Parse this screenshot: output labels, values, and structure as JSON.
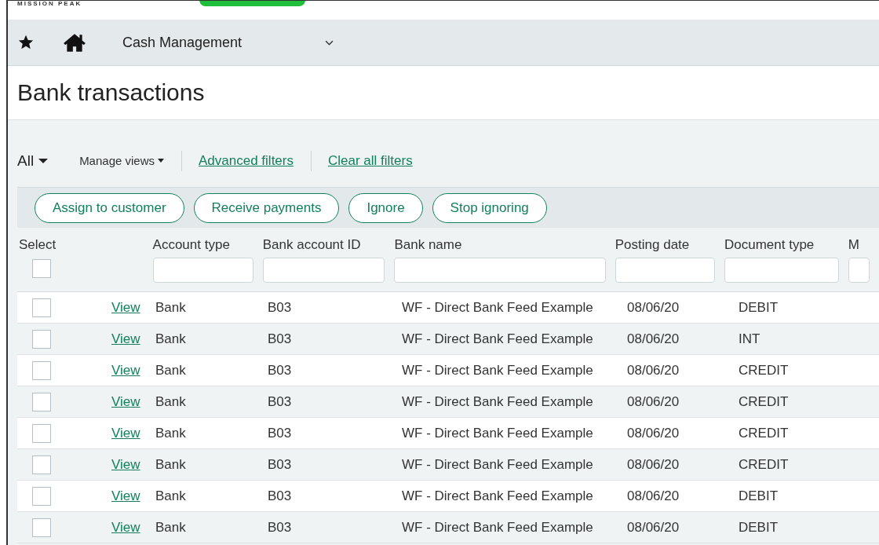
{
  "brand": {
    "logo": "MISSION PEAK"
  },
  "nav": {
    "module": "Cash Management"
  },
  "page": {
    "title": "Bank transactions"
  },
  "filters": {
    "view": "All",
    "manage_views": "Manage views",
    "links": [
      "Advanced filters",
      "Clear all filters"
    ]
  },
  "actions": [
    "Assign to customer",
    "Receive payments",
    "Ignore",
    "Stop ignoring"
  ],
  "table": {
    "select_label": "Select",
    "select_all": {
      "checked": false
    },
    "columns": [
      "Account type",
      "Bank account ID",
      "Bank name",
      "Posting date",
      "Document type",
      "M"
    ],
    "rows": [
      {
        "checked": false,
        "link": "View",
        "cells": [
          "Bank",
          "B03",
          "WF - Direct Bank Feed Example",
          "08/06/20",
          "DEBIT"
        ]
      },
      {
        "checked": false,
        "link": "View",
        "cells": [
          "Bank",
          "B03",
          "WF - Direct Bank Feed Example",
          "08/06/20",
          "INT"
        ]
      },
      {
        "checked": false,
        "link": "View",
        "cells": [
          "Bank",
          "B03",
          "WF - Direct Bank Feed Example",
          "08/06/20",
          "CREDIT"
        ]
      },
      {
        "checked": false,
        "link": "View",
        "cells": [
          "Bank",
          "B03",
          "WF - Direct Bank Feed Example",
          "08/06/20",
          "CREDIT"
        ]
      },
      {
        "checked": false,
        "link": "View",
        "cells": [
          "Bank",
          "B03",
          "WF - Direct Bank Feed Example",
          "08/06/20",
          "CREDIT"
        ]
      },
      {
        "checked": false,
        "link": "View",
        "cells": [
          "Bank",
          "B03",
          "WF - Direct Bank Feed Example",
          "08/06/20",
          "CREDIT"
        ]
      },
      {
        "checked": false,
        "link": "View",
        "cells": [
          "Bank",
          "B03",
          "WF - Direct Bank Feed Example",
          "08/06/20",
          "DEBIT"
        ]
      },
      {
        "checked": false,
        "link": "View",
        "cells": [
          "Bank",
          "B03",
          "WF - Direct Bank Feed Example",
          "08/06/20",
          "DEBIT"
        ]
      }
    ]
  }
}
